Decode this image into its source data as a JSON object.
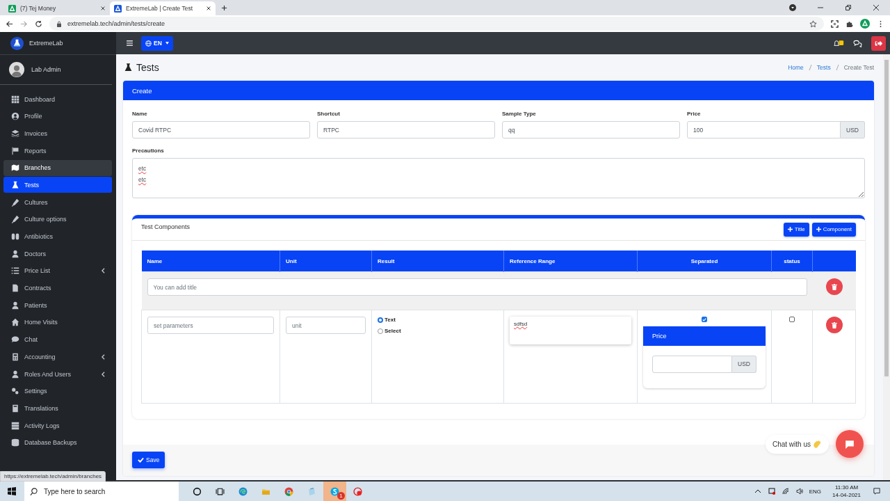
{
  "browser": {
    "tabs": [
      {
        "title": "(7) Tej Money",
        "selected": false
      },
      {
        "title": "ExtremeLab | Create Test",
        "selected": true
      }
    ],
    "url": "extremelab.tech/admin/tests/create"
  },
  "app": {
    "brand": "ExtremeLab",
    "user": "Lab Admin",
    "language": "EN"
  },
  "sidebar": {
    "items": [
      {
        "label": "Dashboard",
        "selected": false,
        "hovered": false,
        "submenu": false
      },
      {
        "label": "Profile",
        "selected": false,
        "hovered": false,
        "submenu": false
      },
      {
        "label": "Invoices",
        "selected": false,
        "hovered": false,
        "submenu": false
      },
      {
        "label": "Reports",
        "selected": false,
        "hovered": false,
        "submenu": false
      },
      {
        "label": "Branches",
        "selected": false,
        "hovered": true,
        "submenu": false
      },
      {
        "label": "Tests",
        "selected": true,
        "hovered": false,
        "submenu": false
      },
      {
        "label": "Cultures",
        "selected": false,
        "hovered": false,
        "submenu": false
      },
      {
        "label": "Culture options",
        "selected": false,
        "hovered": false,
        "submenu": false
      },
      {
        "label": "Antibiotics",
        "selected": false,
        "hovered": false,
        "submenu": false
      },
      {
        "label": "Doctors",
        "selected": false,
        "hovered": false,
        "submenu": false
      },
      {
        "label": "Price List",
        "selected": false,
        "hovered": false,
        "submenu": true
      },
      {
        "label": "Contracts",
        "selected": false,
        "hovered": false,
        "submenu": false
      },
      {
        "label": "Patients",
        "selected": false,
        "hovered": false,
        "submenu": false
      },
      {
        "label": "Home Visits",
        "selected": false,
        "hovered": false,
        "submenu": false
      },
      {
        "label": "Chat",
        "selected": false,
        "hovered": false,
        "submenu": false
      },
      {
        "label": "Accounting",
        "selected": false,
        "hovered": false,
        "submenu": true
      },
      {
        "label": "Roles And Users",
        "selected": false,
        "hovered": false,
        "submenu": true
      },
      {
        "label": "Settings",
        "selected": false,
        "hovered": false,
        "submenu": false
      },
      {
        "label": "Translations",
        "selected": false,
        "hovered": false,
        "submenu": false
      },
      {
        "label": "Activity Logs",
        "selected": false,
        "hovered": false,
        "submenu": false
      },
      {
        "label": "Database Backups",
        "selected": false,
        "hovered": false,
        "submenu": false
      }
    ]
  },
  "page": {
    "title": "Tests",
    "breadcrumbs": [
      {
        "label": "Home",
        "link": true
      },
      {
        "label": "Tests",
        "link": true
      },
      {
        "label": "Create Test",
        "link": false
      }
    ]
  },
  "form": {
    "header": "Create",
    "fields": [
      {
        "label": "Name",
        "value": "Covid RTPC"
      },
      {
        "label": "Shortcut",
        "value": "RTPC"
      },
      {
        "label": "Sample Type",
        "value": "qq"
      },
      {
        "label": "Price",
        "value": "100",
        "addon": "USD"
      }
    ],
    "precautions": {
      "label": "Precautions",
      "value": "etc\netc"
    }
  },
  "components": {
    "title": "Test Components",
    "buttons": [
      "Title",
      "Component"
    ],
    "columns": [
      "Name",
      "Unit",
      "Result",
      "Reference Range",
      "Separated",
      "status"
    ],
    "title_row": {
      "placeholder": "You can add title"
    },
    "rows": [
      {
        "name_placeholder": "set parameters",
        "unit_placeholder": "unit",
        "result_options": [
          {
            "label": "Text",
            "selected": true
          },
          {
            "label": "Select",
            "selected": false
          }
        ],
        "reference_range": "sdfsd",
        "separated": true,
        "price_title": "Price",
        "price_addon": "USD",
        "status": false
      }
    ]
  },
  "save_button": "Save",
  "status_url": "https://extremelab.tech/admin/branches",
  "chat_widget": {
    "label": "Chat with us"
  },
  "taskbar": {
    "search_placeholder": "Type here to search",
    "skype_badge": "1",
    "language": "ENG",
    "time": "11:30 AM",
    "date": "14-04-2021"
  }
}
